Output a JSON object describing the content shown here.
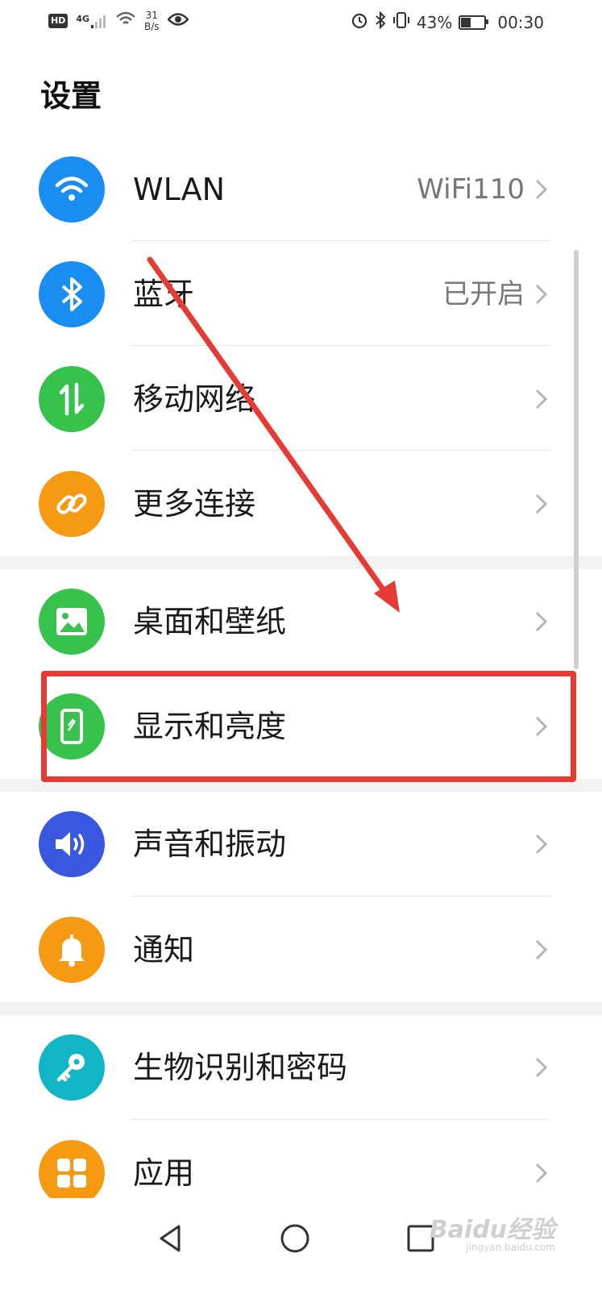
{
  "status_bar": {
    "left_hd": "HD",
    "left_signal": "4G",
    "speed_value": "31",
    "speed_unit": "B/s",
    "battery": "43%",
    "time": "00:30"
  },
  "page": {
    "title": "设置"
  },
  "settings": [
    {
      "label": "WLAN",
      "value": "WiFi110",
      "icon": "wifi-icon",
      "color": "#1a8ef0"
    },
    {
      "label": "蓝牙",
      "value": "已开启",
      "icon": "bluetooth-icon",
      "color": "#1a8ef0"
    },
    {
      "label": "移动网络",
      "value": "",
      "icon": "mobile-data-icon",
      "color": "#37c24d"
    },
    {
      "label": "更多连接",
      "value": "",
      "icon": "link-icon",
      "color": "#f59a12"
    },
    {
      "label": "桌面和壁纸",
      "value": "",
      "icon": "wallpaper-icon",
      "color": "#37c24d"
    },
    {
      "label": "显示和亮度",
      "value": "",
      "icon": "display-icon",
      "color": "#37c24d"
    },
    {
      "label": "声音和振动",
      "value": "",
      "icon": "sound-icon",
      "color": "#3a57e0"
    },
    {
      "label": "通知",
      "value": "",
      "icon": "bell-icon",
      "color": "#f59a12"
    },
    {
      "label": "生物识别和密码",
      "value": "",
      "icon": "key-icon",
      "color": "#12b5c6"
    },
    {
      "label": "应用",
      "value": "",
      "icon": "apps-icon",
      "color": "#f59a12"
    }
  ],
  "watermark": {
    "text": "Baidu经验",
    "sub": "jingyan.baidu.com"
  },
  "annotation_color": "#e63a35"
}
